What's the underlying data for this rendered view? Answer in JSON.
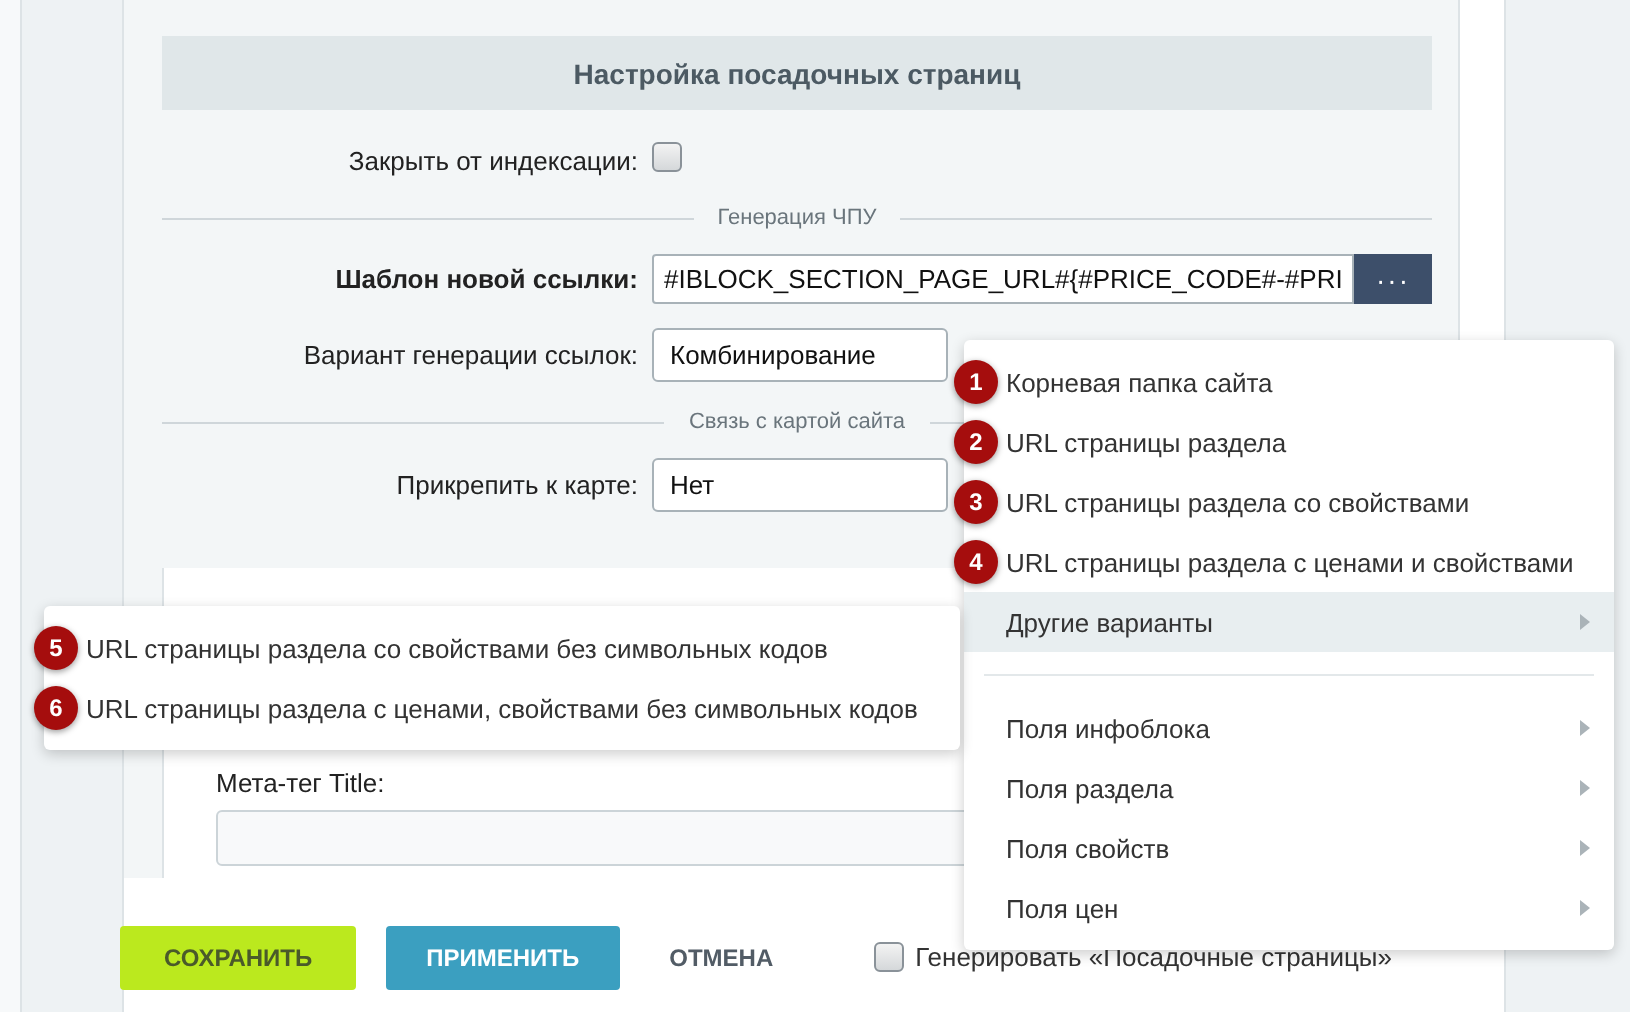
{
  "section_title": "Настройка посадочных страниц",
  "noindex": {
    "label": "Закрыть от индексации:",
    "checked": false
  },
  "divider_sef": "Генерация ЧПУ",
  "template": {
    "label": "Шаблон новой ссылки:",
    "value": "#IBLOCK_SECTION_PAGE_URL#{#PRICE_CODE#-#PRI",
    "button": "···"
  },
  "variant": {
    "label": "Вариант генерации ссылок:",
    "value": "Комбинирование"
  },
  "divider_sitemap": "Связь с картой сайта",
  "sitemap": {
    "label": "Прикрепить к карте:",
    "value": "Нет"
  },
  "meta_title": {
    "label": "Мета-тег Title:"
  },
  "footer": {
    "save": "СОХРАНИТЬ",
    "apply": "ПРИМЕНИТЬ",
    "cancel": "ОТМЕНА",
    "generate": {
      "label": "Генерировать «Посадочные страницы»",
      "checked": false
    }
  },
  "menu": {
    "items": [
      {
        "badge": "1",
        "label": "Корневая папка сайта",
        "has_submenu": false,
        "highlighted": false
      },
      {
        "badge": "2",
        "label": "URL страницы раздела",
        "has_submenu": false,
        "highlighted": false
      },
      {
        "badge": "3",
        "label": "URL страницы раздела со свойствами",
        "has_submenu": false,
        "highlighted": false
      },
      {
        "badge": "4",
        "label": "URL страницы раздела с ценами и свойствами",
        "has_submenu": false,
        "highlighted": false
      },
      {
        "label": "Другие варианты",
        "has_submenu": true,
        "highlighted": true
      }
    ],
    "field_items": [
      {
        "label": "Поля инфоблока",
        "has_submenu": true,
        "highlighted": false
      },
      {
        "label": "Поля раздела",
        "has_submenu": true,
        "highlighted": false
      },
      {
        "label": "Поля свойств",
        "has_submenu": true,
        "highlighted": false
      },
      {
        "label": "Поля цен",
        "has_submenu": true,
        "highlighted": false
      }
    ]
  },
  "submenu": {
    "items": [
      {
        "badge": "5",
        "label": "URL страницы раздела со свойствами без символьных кодов",
        "has_submenu": false,
        "highlighted": false
      },
      {
        "badge": "6",
        "label": "URL страницы раздела с ценами, свойствами без символьных кодов",
        "has_submenu": false,
        "highlighted": false
      }
    ]
  }
}
